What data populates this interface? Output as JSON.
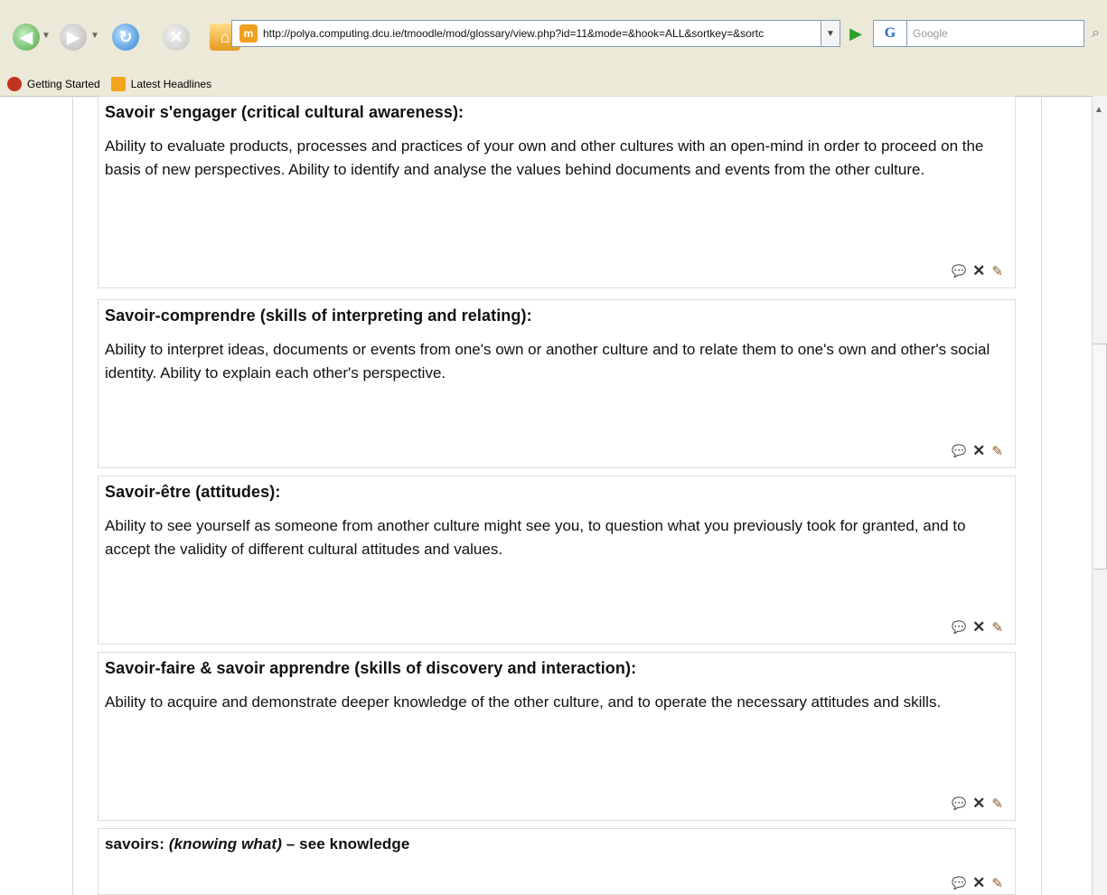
{
  "browser": {
    "url": "http://polya.computing.dcu.ie/tmoodle/mod/glossary/view.php?id=11&mode=&hook=ALL&sortkey=&sortc",
    "search_engine_label": "G",
    "search_placeholder": "Google",
    "bookmarks": [
      {
        "label": "Getting Started"
      },
      {
        "label": "Latest Headlines"
      }
    ]
  },
  "entries": [
    {
      "title": "Savoir s'engager (critical cultural awareness):",
      "text": "Ability to evaluate products, processes and practices of your own and other cultures with an open-mind in order to proceed on the basis of new perspectives. Ability to identify and analyse the values behind documents and events from the other culture."
    },
    {
      "title": "Savoir-comprendre (skills of interpreting and relating):",
      "text": "Ability to interpret ideas, documents or events from one's own or another culture and to relate them to one's own and other's social identity. Ability to explain each other's perspective."
    },
    {
      "title": "Savoir-être (attitudes):",
      "text": "Ability to see yourself as someone from another culture might see you, to question what you previously took for granted, and to accept the validity of different cultural attitudes and values."
    },
    {
      "title": "Savoir-faire & savoir apprendre (skills of discovery and interaction):",
      "text": "Ability to acquire and demonstrate deeper knowledge of the other culture, and to operate the necessary attitudes and skills."
    },
    {
      "term": "savoirs:",
      "italic_text": "(knowing what)",
      "text": "– see knowledge"
    }
  ]
}
